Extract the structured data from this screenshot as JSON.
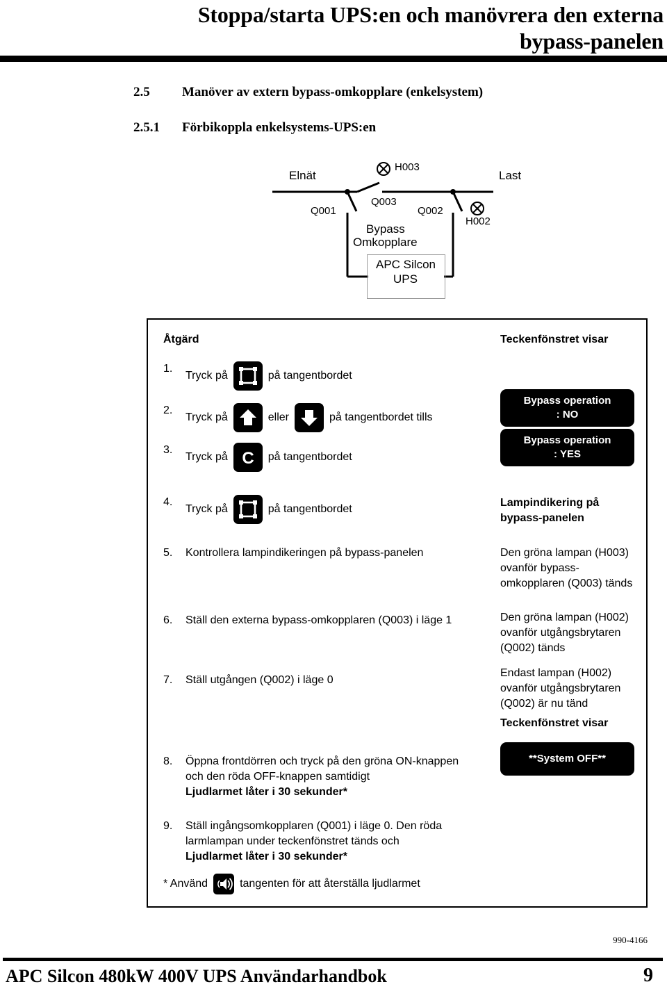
{
  "page": {
    "title_line1": "Stoppa/starta UPS:en och manövrera den externa",
    "title_line2": "bypass-panelen",
    "doc_code": "990-4166",
    "footer_title": "APC Silcon 480kW 400V UPS Användarhandbok",
    "footer_page": "9"
  },
  "sections": [
    {
      "number": "2.5",
      "title": "Manöver av extern bypass-omkopplare (enkelsystem)"
    },
    {
      "number": "2.5.1",
      "title": "Förbikoppla enkelsystems-UPS:en"
    }
  ],
  "diagram": {
    "mains_label": "Elnät",
    "load_label": "Last",
    "lamp_h003": "H003",
    "lamp_h002": "H002",
    "switch_q001": "Q001",
    "switch_q002": "Q002",
    "switch_q003": "Q003",
    "bypass_line1": "Bypass",
    "bypass_line2": "Omkopplare",
    "ups_line1": "APC Silcon",
    "ups_line2": "UPS"
  },
  "table": {
    "header_action": "Åtgärd",
    "header_display": "Teckenfönstret visar",
    "header_display_2": "Teckenfönstret visar",
    "steps": {
      "s1": {
        "num": "1.",
        "pre": "Tryck på",
        "post": "på tangentbordet",
        "key": "frame-key"
      },
      "s2": {
        "num": "2.",
        "pre": "Tryck på",
        "mid": "eller",
        "post": "på tangentbordet tills",
        "key1": "up-arrow-key",
        "key2": "down-arrow-key"
      },
      "s3": {
        "num": "3.",
        "pre": "Tryck på",
        "post": "på tangentbordet",
        "key": "c-key"
      },
      "s4": {
        "num": "4.",
        "pre": "Tryck på",
        "post": "på tangentbordet",
        "key": "frame-key"
      },
      "s5": {
        "num": "5.",
        "text": "Kontrollera lampindikeringen på bypass-panelen"
      },
      "s6": {
        "num": "6.",
        "text": "Ställ den externa bypass-omkopplaren (Q003) i läge 1"
      },
      "s7": {
        "num": "7.",
        "text": "Ställ utgången (Q002) i läge 0"
      },
      "s8": {
        "num": "8.",
        "line1": "Öppna frontdörren och tryck på den gröna ON-knappen",
        "line2": "och den röda OFF-knappen samtidigt",
        "line3": "Ljudlarmet låter i 30 sekunder*"
      },
      "s9": {
        "num": "9.",
        "line1": "Ställ ingångsomkopplaren (Q001) i läge 0. Den röda",
        "line2": "larmlampan under teckenfönstret tänds och",
        "line3": "Ljudlarmet låter i 30 sekunder*"
      },
      "footnote": {
        "pre": "* Använd",
        "post": "tangenten  för att återställa ljudlarmet",
        "key": "alarm-silence-key"
      }
    },
    "results": {
      "lcd1_line1": "Bypass operation",
      "lcd1_line2": ": NO",
      "lcd2_line1": "Bypass operation",
      "lcd2_line2": ": YES",
      "r4_line1": "Lampindikering på",
      "r4_line2": "bypass-panelen",
      "r5_line1": "Den gröna lampan (H003)",
      "r5_line2": "ovanför bypass-",
      "r5_line3": "omkopplaren (Q003) tänds",
      "r6_line1": "Den gröna lampan (H002)",
      "r6_line2": "ovanför utgångsbrytaren",
      "r6_line3": "(Q002) tänds",
      "r7_line1": "Endast lampan (H002)",
      "r7_line2": "ovanför utgångsbrytaren",
      "r7_line3": "(Q002) är nu tänd",
      "lcd3_text": "**System OFF**"
    }
  },
  "colors": {
    "ink": "#000000",
    "paper": "#ffffff",
    "box_border": "#9a9a9a"
  }
}
